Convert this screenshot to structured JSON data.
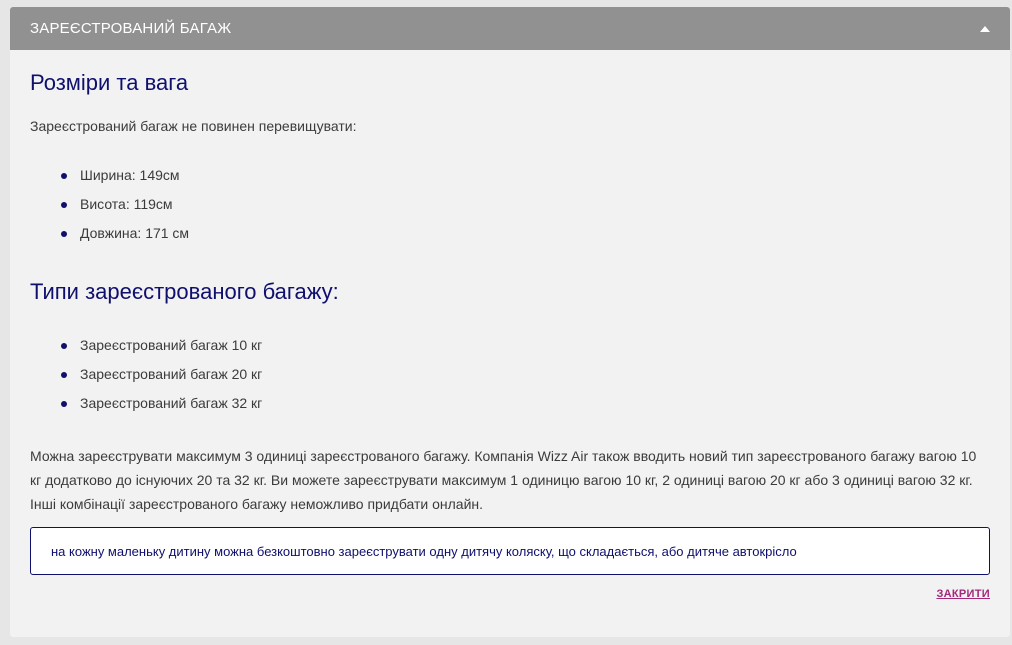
{
  "header": {
    "title": "ЗАРЕЄСТРОВАНИЙ БАГАЖ",
    "toggle_icon": "caret-up-icon"
  },
  "sizes": {
    "heading": "Розміри та вага",
    "intro": "Зареєстрований багаж не повинен перевищувати:",
    "items": [
      "Ширина: 149см",
      "Висота: 119см",
      "Довжина: 171 см"
    ]
  },
  "types": {
    "heading": "Типи зареєстрованого багажу:",
    "items": [
      "Зареєстрований багаж 10 кг",
      "Зареєстрований багаж 20 кг",
      "Зареєстрований багаж 32 кг"
    ]
  },
  "paragraph": "Можна зареєструвати максимум 3 одиниці зареєстрованого багажу. Компанія Wizz Air також вводить новий тип зареєстрованого багажу вагою 10 кг додатково до існуючих 20 та 32 кг. Ви можете зареєструвати максимум 1 одиницю вагою 10 кг, 2 одиниці вагою 20 кг або 3 одиниці вагою 32 кг. Інші комбінації зареєстрованого багажу неможливо придбати онлайн.",
  "note": "на кожну маленьку дитину можна безкоштовно зареєструвати одну дитячу коляску, що складається, або дитяче автокрісло",
  "close_label": "ЗАКРИТИ",
  "colors": {
    "header_bg": "#919191",
    "heading": "#0f0f6e",
    "close_link": "#a3287a"
  }
}
